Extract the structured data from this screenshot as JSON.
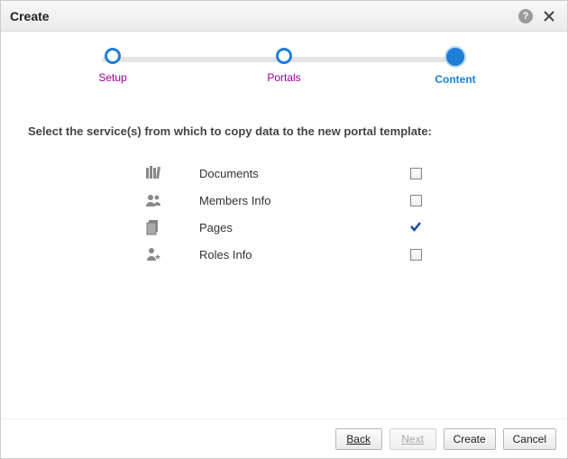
{
  "header": {
    "title": "Create"
  },
  "stepper": {
    "steps": [
      {
        "label": "Setup",
        "state": "done"
      },
      {
        "label": "Portals",
        "state": "done"
      },
      {
        "label": "Content",
        "state": "current"
      }
    ]
  },
  "instruction": "Select the service(s) from which to copy data to the new portal template:",
  "services": [
    {
      "icon": "documents-icon",
      "label": "Documents",
      "checked": false
    },
    {
      "icon": "members-icon",
      "label": "Members Info",
      "checked": false
    },
    {
      "icon": "pages-icon",
      "label": "Pages",
      "checked": true
    },
    {
      "icon": "roles-icon",
      "label": "Roles Info",
      "checked": false
    }
  ],
  "footer": {
    "back": "Back",
    "next": "Next",
    "create": "Create",
    "cancel": "Cancel",
    "next_disabled": true
  }
}
